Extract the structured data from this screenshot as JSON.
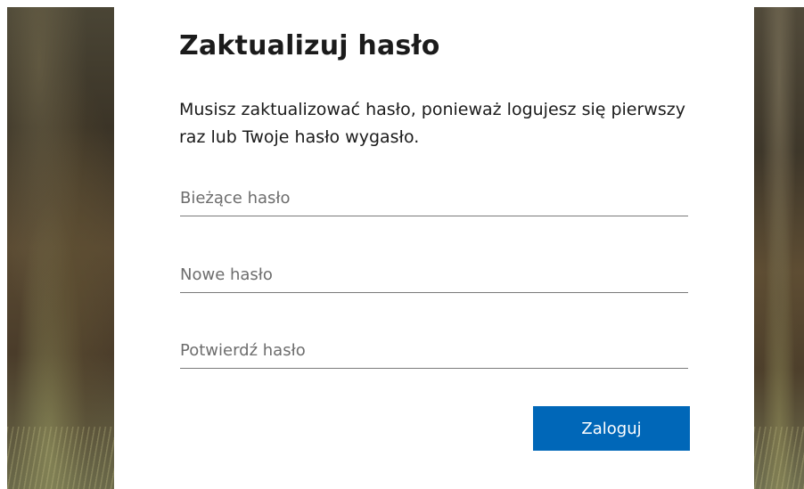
{
  "dialog": {
    "title": "Zaktualizuj hasło",
    "description": "Musisz zaktualizować hasło, ponieważ logujesz się pierwszy raz lub Twoje hasło wygasło.",
    "fields": {
      "current_password": {
        "placeholder": "Bieżące hasło",
        "value": ""
      },
      "new_password": {
        "placeholder": "Nowe hasło",
        "value": ""
      },
      "confirm_password": {
        "placeholder": "Potwierdź hasło",
        "value": ""
      }
    },
    "submit_label": "Zaloguj"
  },
  "colors": {
    "accent": "#0067b8",
    "text": "#1b1b1b",
    "placeholder": "#6d6d6d",
    "underline": "#7a7a7a"
  }
}
